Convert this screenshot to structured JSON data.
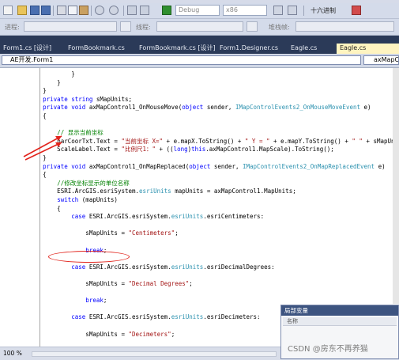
{
  "toolbar": {
    "config_dropdown": "Debug",
    "platform_dropdown": "x86",
    "hex_label": "十六进制",
    "icon_names": [
      "new-project-icon",
      "open-icon",
      "save-icon",
      "save-all-icon",
      "cut-icon",
      "copy-icon",
      "paste-icon",
      "undo-icon",
      "redo-icon",
      "nav-back-icon",
      "nav-forward-icon",
      "start-debug-icon",
      "find-icon",
      "solution-explorer-icon"
    ]
  },
  "debug_toolbar": {
    "process_label": "进程:",
    "thread_label": "线程:",
    "stack_label": "堆栈帧:"
  },
  "tabs": [
    {
      "label": "Form1.cs [设计]",
      "active": false
    },
    {
      "label": "FormBookmark.cs",
      "active": false
    },
    {
      "label": "FormBookmark.cs [设计]",
      "active": false
    },
    {
      "label": "Form1.Designer.cs",
      "active": false
    },
    {
      "label": "Eagle.cs",
      "active": false
    },
    {
      "label": "Eagle.cs",
      "active": true
    }
  ],
  "nav": {
    "class_dropdown": "AE开发.Form1",
    "member_dropdown": "axMapCon"
  },
  "code_lines": [
    {
      "segments": [
        {
          "t": "                }",
          "c": ""
        }
      ]
    },
    {
      "segments": [
        {
          "t": "            }",
          "c": ""
        }
      ]
    },
    {
      "segments": [
        {
          "t": "        }",
          "c": ""
        }
      ]
    },
    {
      "segments": [
        {
          "t": "        ",
          "c": ""
        },
        {
          "t": "private string",
          "c": "kw"
        },
        {
          "t": " sMapUnits;",
          "c": ""
        }
      ]
    },
    {
      "segments": [
        {
          "t": "        ",
          "c": ""
        },
        {
          "t": "private void",
          "c": "kw"
        },
        {
          "t": " axMapControl1_OnMouseMove(",
          "c": ""
        },
        {
          "t": "object",
          "c": "kw"
        },
        {
          "t": " sender, ",
          "c": ""
        },
        {
          "t": "IMapControlEvents2_OnMouseMoveEvent",
          "c": "ty"
        },
        {
          "t": " e)",
          "c": ""
        }
      ]
    },
    {
      "segments": [
        {
          "t": "        {",
          "c": ""
        }
      ]
    },
    {
      "segments": [
        {
          "t": "",
          "c": ""
        }
      ]
    },
    {
      "segments": [
        {
          "t": "            ",
          "c": ""
        },
        {
          "t": "// 显示当前坐标",
          "c": "cm"
        }
      ]
    },
    {
      "segments": [
        {
          "t": "            barCoorTxt.Text = ",
          "c": ""
        },
        {
          "t": "\"当前坐标 X=\"",
          "c": "st"
        },
        {
          "t": " + e.mapX.ToString() + ",
          "c": ""
        },
        {
          "t": "\" Y = \"",
          "c": "st"
        },
        {
          "t": " + e.mapY.ToString() + ",
          "c": ""
        },
        {
          "t": "\" \"",
          "c": "st"
        },
        {
          "t": " + sMapUnits;",
          "c": ""
        }
      ]
    },
    {
      "segments": [
        {
          "t": "            ScaleLabel.Text = ",
          "c": ""
        },
        {
          "t": "\"比例尺1：\"",
          "c": "st"
        },
        {
          "t": " + ((",
          "c": ""
        },
        {
          "t": "long",
          "c": "kw"
        },
        {
          "t": ")",
          "c": ""
        },
        {
          "t": "this",
          "c": "kw"
        },
        {
          "t": ".axMapControl1.MapScale).ToString();",
          "c": ""
        }
      ]
    },
    {
      "segments": [
        {
          "t": "        }",
          "c": ""
        }
      ]
    },
    {
      "segments": [
        {
          "t": "        ",
          "c": ""
        },
        {
          "t": "private void",
          "c": "kw"
        },
        {
          "t": " axMapControl1_OnMapReplaced(",
          "c": ""
        },
        {
          "t": "object",
          "c": "kw"
        },
        {
          "t": " sender, ",
          "c": ""
        },
        {
          "t": "IMapControlEvents2_OnMapReplacedEvent",
          "c": "ty"
        },
        {
          "t": " e)",
          "c": ""
        }
      ]
    },
    {
      "segments": [
        {
          "t": "        {",
          "c": ""
        }
      ]
    },
    {
      "segments": [
        {
          "t": "            ",
          "c": ""
        },
        {
          "t": "//修改坐标显示的单位名称",
          "c": "cm"
        }
      ]
    },
    {
      "segments": [
        {
          "t": "            ESRI.ArcGIS.esriSystem.",
          "c": ""
        },
        {
          "t": "esriUnits",
          "c": "ty"
        },
        {
          "t": " mapUnits = axMapControl1.MapUnits;",
          "c": ""
        }
      ]
    },
    {
      "segments": [
        {
          "t": "            ",
          "c": ""
        },
        {
          "t": "switch",
          "c": "kw"
        },
        {
          "t": " (mapUnits)",
          "c": ""
        }
      ]
    },
    {
      "segments": [
        {
          "t": "            {",
          "c": ""
        }
      ]
    },
    {
      "segments": [
        {
          "t": "                ",
          "c": ""
        },
        {
          "t": "case",
          "c": "kw"
        },
        {
          "t": " ESRI.ArcGIS.esriSystem.",
          "c": ""
        },
        {
          "t": "esriUnits",
          "c": "ty"
        },
        {
          "t": ".esriCentimeters:",
          "c": ""
        }
      ]
    },
    {
      "segments": [
        {
          "t": "",
          "c": ""
        }
      ]
    },
    {
      "segments": [
        {
          "t": "                    sMapUnits = ",
          "c": ""
        },
        {
          "t": "\"Centimeters\"",
          "c": "st"
        },
        {
          "t": ";",
          "c": ""
        }
      ]
    },
    {
      "segments": [
        {
          "t": "",
          "c": ""
        }
      ]
    },
    {
      "segments": [
        {
          "t": "                    ",
          "c": ""
        },
        {
          "t": "break",
          "c": "kw"
        },
        {
          "t": ";",
          "c": ""
        }
      ]
    },
    {
      "segments": [
        {
          "t": "",
          "c": ""
        }
      ]
    },
    {
      "segments": [
        {
          "t": "                ",
          "c": ""
        },
        {
          "t": "case",
          "c": "kw"
        },
        {
          "t": " ESRI.ArcGIS.esriSystem.",
          "c": ""
        },
        {
          "t": "esriUnits",
          "c": "ty"
        },
        {
          "t": ".esriDecimalDegrees:",
          "c": ""
        }
      ]
    },
    {
      "segments": [
        {
          "t": "",
          "c": ""
        }
      ]
    },
    {
      "segments": [
        {
          "t": "                    sMapUnits = ",
          "c": ""
        },
        {
          "t": "\"Decimal Degrees\"",
          "c": "st"
        },
        {
          "t": ";",
          "c": ""
        }
      ]
    },
    {
      "segments": [
        {
          "t": "",
          "c": ""
        }
      ]
    },
    {
      "segments": [
        {
          "t": "                    ",
          "c": ""
        },
        {
          "t": "break",
          "c": "kw"
        },
        {
          "t": ";",
          "c": ""
        }
      ]
    },
    {
      "segments": [
        {
          "t": "",
          "c": ""
        }
      ]
    },
    {
      "segments": [
        {
          "t": "                ",
          "c": ""
        },
        {
          "t": "case",
          "c": "kw"
        },
        {
          "t": " ESRI.ArcGIS.esriSystem.",
          "c": ""
        },
        {
          "t": "esriUnits",
          "c": "ty"
        },
        {
          "t": ".esriDecimeters:",
          "c": ""
        }
      ]
    },
    {
      "segments": [
        {
          "t": "",
          "c": ""
        }
      ]
    },
    {
      "segments": [
        {
          "t": "                    sMapUnits = ",
          "c": ""
        },
        {
          "t": "\"Decimeters\"",
          "c": "st"
        },
        {
          "t": ";",
          "c": ""
        }
      ]
    },
    {
      "segments": [
        {
          "t": "",
          "c": ""
        }
      ]
    },
    {
      "segments": [
        {
          "t": "                    ",
          "c": ""
        },
        {
          "t": "break",
          "c": "kw"
        },
        {
          "t": ";",
          "c": ""
        }
      ]
    }
  ],
  "panel": {
    "title": "局部变量",
    "column_name": "名称"
  },
  "status": {
    "zoom": "100 %"
  },
  "watermark": "CSDN @房东不再养猫",
  "colors": {
    "keyword": "#0000ff",
    "type": "#2b91af",
    "string": "#a31515",
    "comment": "#008000",
    "annotation": "#e2241c"
  }
}
